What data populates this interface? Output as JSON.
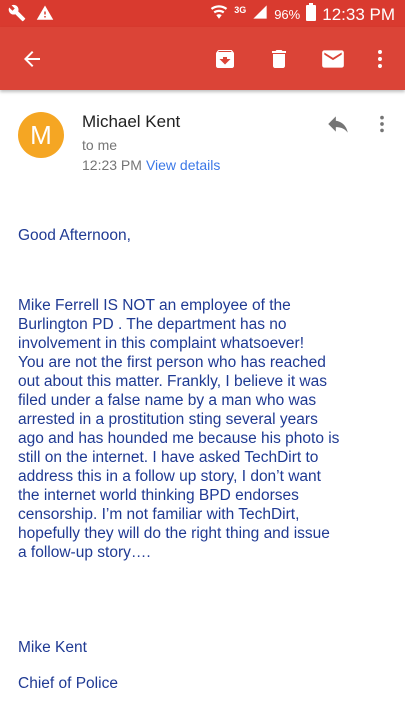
{
  "status_bar": {
    "network": "3G",
    "battery": "96%",
    "time": "12:33 PM"
  },
  "app_bar": {
    "icons": [
      "back-arrow-icon",
      "archive-icon",
      "delete-icon",
      "mark-unread-icon",
      "more-vert-icon"
    ]
  },
  "message": {
    "avatar_letter": "M",
    "sender": "Michael Kent",
    "recipient": "to me",
    "time": "12:23 PM",
    "view_details": "View details",
    "greeting": "Good Afternoon,",
    "body": "Mike Ferrell IS NOT an employee of the\nBurlington PD .  The department has no\ninvolvement in this complaint whatsoever!\nYou are not the first person who has reached\nout about this matter.  Frankly, I believe it was\nfiled under a false name by a man who was\narrested in a prostitution sting several years\nago and has hounded me because his photo is\nstill on the internet.  I have asked TechDirt to\naddress this in a follow up story, I don’t want\n the internet world thinking BPD endorses\ncensorship.  I’m not familiar  with TechDirt,\nhopefully they will do the right thing and issue\na follow-up story….",
    "signature_name": "Mike Kent",
    "signature_title": "Chief of Police"
  },
  "colors": {
    "status_bar": "#d93a2f",
    "app_bar": "#db4437",
    "avatar": "#f5a623",
    "link": "#3b78e7",
    "body_text": "#1f3a93"
  }
}
